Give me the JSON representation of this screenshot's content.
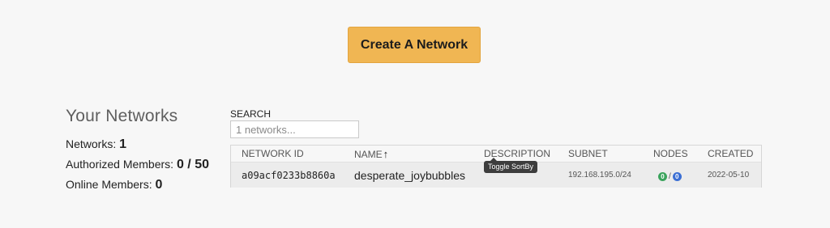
{
  "actions": {
    "create_network_label": "Create A Network"
  },
  "summary": {
    "heading": "Your Networks",
    "networks_label": "Networks:",
    "networks_value": "1",
    "authorized_label": "Authorized Members:",
    "authorized_value": "0 / 50",
    "online_label": "Online Members:",
    "online_value": "0"
  },
  "search": {
    "label": "SEARCH",
    "placeholder": "1 networks..."
  },
  "table": {
    "columns": {
      "network_id": "NETWORK ID",
      "name": "NAME",
      "name_sort_icon": "arrow-up-icon",
      "name_sort_glyph": "↑",
      "description": "DESCRIPTION",
      "subnet": "SUBNET",
      "nodes": "NODES",
      "created": "CREATED"
    },
    "rows": [
      {
        "network_id": "a09acf0233b8860a",
        "name": "desperate_joybubbles",
        "description": "",
        "subnet": "192.168.195.0/24",
        "nodes_online": "0",
        "nodes_separator": "/",
        "nodes_total": "0",
        "created": "2022-05-10"
      }
    ]
  },
  "tooltip": {
    "text": "Toggle SortBy"
  },
  "colors": {
    "accent": "#f0b653",
    "online_badge": "#3aa35c",
    "total_badge": "#3b6fd4",
    "tooltip_bg": "#3d3d3d"
  }
}
